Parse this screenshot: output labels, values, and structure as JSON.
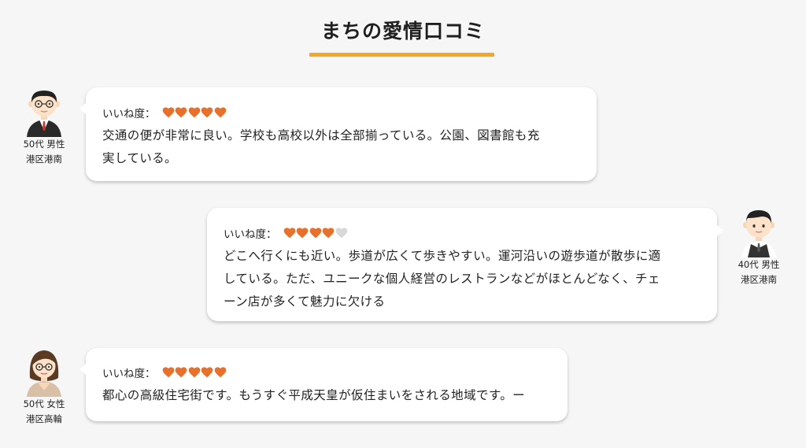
{
  "page_title": "まちの愛情口コミ",
  "rating_label": "いいね度：",
  "colors": {
    "accent": "#f5a623",
    "heart_on": "#e8702a",
    "heart_off": "#d8d8d8"
  },
  "reviews": [
    {
      "age_gender": "50代 男性",
      "area": "港区港南",
      "avatar_icon": "man-glasses-suit-icon",
      "rating": 5,
      "comment_lines": [
        "交通の便が非常に良い。学校も高校以外は全部揃っている。公園、図書館も充",
        "実している。"
      ]
    },
    {
      "age_gender": "40代 男性",
      "area": "港区港南",
      "avatar_icon": "man-vest-icon",
      "rating": 4,
      "comment_lines": [
        "どこへ行くにも近い。歩道が広くて歩きやすい。運河沿いの遊歩道が散歩に適",
        "している。ただ、ユニークな個人経営のレストランなどがほとんどなく、チェ",
        "ーン店が多くて魅力に欠ける"
      ]
    },
    {
      "age_gender": "50代 女性",
      "area": "港区高輪",
      "avatar_icon": "woman-glasses-icon",
      "rating": 5,
      "comment_lines": [
        "都心の高級住宅街です。もうすぐ平成天皇が仮住まいをされる地域です。ー"
      ]
    }
  ]
}
